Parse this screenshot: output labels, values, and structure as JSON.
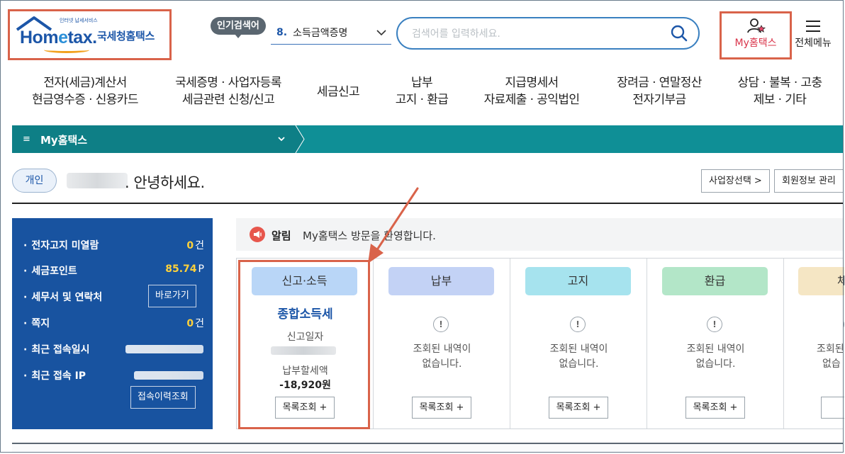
{
  "header": {
    "logo_tagline": "인터넷 납세서비스",
    "logo_word_pre": "Hom",
    "logo_word_e": "e",
    "logo_word_post": "tax.",
    "logo_org": "국세청홈택스",
    "popular_label": "인기검색어",
    "popular_rank": "8.",
    "popular_term": "소득금액증명",
    "search_placeholder": "검색어를 입력하세요.",
    "my_hometax": "My홈택스",
    "all_menu": "전체메뉴"
  },
  "nav": [
    {
      "line1": "전자(세금)계산서",
      "line2": "현금영수증 · 신용카드"
    },
    {
      "line1": "국세증명 · 사업자등록",
      "line2": "세금관련 신청/신고"
    },
    {
      "line1": "세금신고",
      "line2": ""
    },
    {
      "line1": "납부",
      "line2": "고지 · 환급"
    },
    {
      "line1": "지급명세서",
      "line2": "자료제출 · 공익법인"
    },
    {
      "line1": "장려금 · 연말정산",
      "line2": "전자기부금"
    },
    {
      "line1": "상담 · 불복 · 고충",
      "line2": "제보 · 기타"
    }
  ],
  "breadcrumb": {
    "menu_icon": "≡",
    "title": "My홈택스"
  },
  "greeting": {
    "badge": "개인",
    "suffix": ". 안녕하세요.",
    "btn_business": "사업장선택 >",
    "btn_member": "회원정보 관리"
  },
  "summary": {
    "rows": [
      {
        "label": "전자고지 미열람",
        "num": "0",
        "unit": "건"
      },
      {
        "label": "세금포인트",
        "num": "85.74",
        "unit": "P"
      },
      {
        "label": "세무서 및 연락처",
        "button": "바로가기"
      },
      {
        "label": "쪽지",
        "num": "0",
        "unit": "건"
      },
      {
        "label": "최근 접속일시"
      },
      {
        "label": "최근 접속 IP"
      }
    ],
    "history_button": "접속이력조회"
  },
  "notice": {
    "label": "알림",
    "text": "My홈택스 방문을 환영합니다."
  },
  "cards": [
    {
      "tab": "신고·소득",
      "title": "종합소득세",
      "date_label": "신고일자",
      "amount_label": "납부할세액",
      "amount": "-18,920원",
      "button": "목록조회 +"
    },
    {
      "tab": "납부",
      "empty1": "조회된 내역이",
      "empty2": "없습니다.",
      "button": "목록조회 +"
    },
    {
      "tab": "고지",
      "empty1": "조회된 내역이",
      "empty2": "없습니다.",
      "button": "목록조회 +"
    },
    {
      "tab": "환급",
      "empty1": "조회된 내역이",
      "empty2": "없습니다.",
      "button": "목록조회 +"
    },
    {
      "tab": "체",
      "empty1": "조회된",
      "empty2": "없습",
      "button": "목"
    }
  ],
  "colors": {
    "brand_blue": "#1c56a8",
    "teal": "#0f8f96",
    "highlight": "#d9634a",
    "card_report": "#b9d6f7",
    "card_pay": "#c3d2f5",
    "card_notice": "#a6e3ee",
    "card_refund": "#b3e6c8",
    "card_other": "#f5e6c4"
  }
}
